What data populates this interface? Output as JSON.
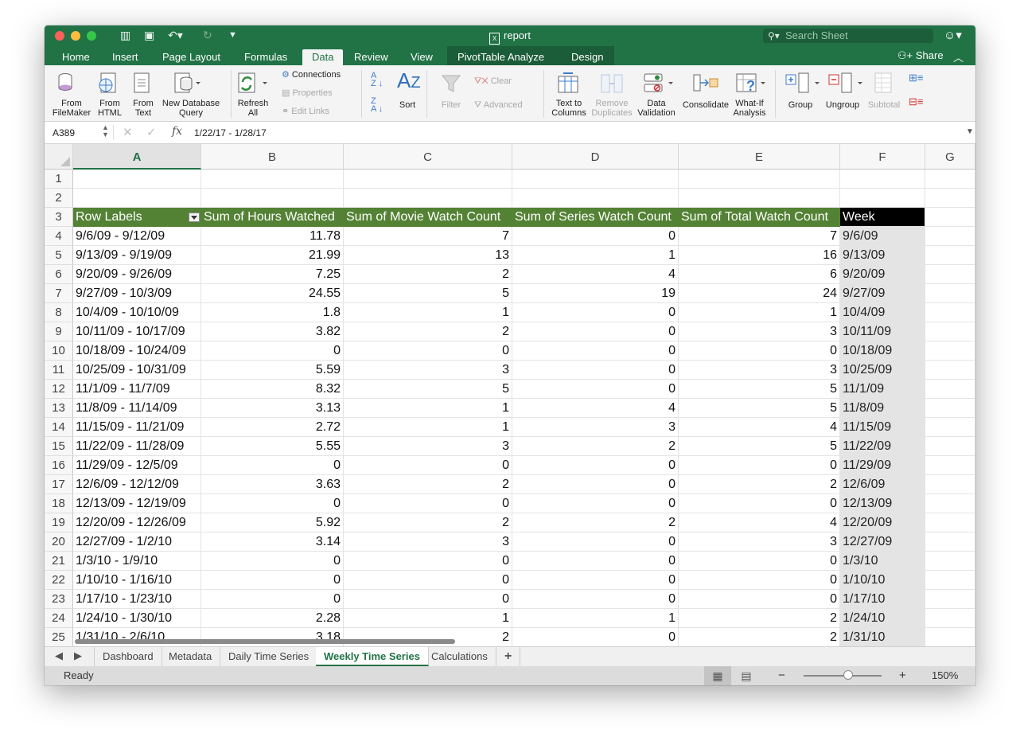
{
  "window": {
    "title": "report",
    "search_placeholder": "Search Sheet",
    "quick_access": [
      "sidebar-icon",
      "save-icon",
      "undo-icon",
      "redo-icon",
      "customize-icon"
    ]
  },
  "tabs": [
    "Home",
    "Insert",
    "Page Layout",
    "Formulas",
    "Data",
    "Review",
    "View",
    "PivotTable Analyze",
    "Design"
  ],
  "active_tab": "Data",
  "share_label": "Share",
  "ribbon": {
    "from_filemaker": "From\nFileMaker",
    "from_html": "From\nHTML",
    "from_text": "From\nText",
    "new_db_query": "New Database\nQuery",
    "refresh_all": "Refresh\nAll",
    "connections": "Connections",
    "properties": "Properties",
    "edit_links": "Edit Links",
    "sort": "Sort",
    "filter": "Filter",
    "clear": "Clear",
    "advanced": "Advanced",
    "text_to_columns": "Text to\nColumns",
    "remove_duplicates": "Remove\nDuplicates",
    "data_validation": "Data\nValidation",
    "consolidate": "Consolidate",
    "what_if": "What-If\nAnalysis",
    "group": "Group",
    "ungroup": "Ungroup",
    "subtotal": "Subtotal"
  },
  "formula_bar": {
    "name_box": "A389",
    "fx": "fx",
    "value": "1/22/17 - 1/28/17"
  },
  "columns": [
    "A",
    "B",
    "C",
    "D",
    "E",
    "F",
    "G"
  ],
  "row_numbers": [
    "1",
    "2",
    "3",
    "4",
    "5",
    "6",
    "7",
    "8",
    "9",
    "10",
    "11",
    "12",
    "13",
    "14",
    "15",
    "16",
    "17",
    "18",
    "19",
    "20",
    "21",
    "22",
    "23",
    "24",
    "25"
  ],
  "table": {
    "headers": [
      "Row Labels",
      "Sum of Hours Watched",
      "Sum of Movie Watch Count",
      "Sum of Series Watch Count",
      "Sum of Total Watch Count",
      "Week"
    ],
    "rows": [
      [
        "9/6/09 - 9/12/09",
        "11.78",
        "7",
        "0",
        "7",
        "9/6/09"
      ],
      [
        "9/13/09 - 9/19/09",
        "21.99",
        "13",
        "1",
        "16",
        "9/13/09"
      ],
      [
        "9/20/09 - 9/26/09",
        "7.25",
        "2",
        "4",
        "6",
        "9/20/09"
      ],
      [
        "9/27/09 - 10/3/09",
        "24.55",
        "5",
        "19",
        "24",
        "9/27/09"
      ],
      [
        "10/4/09 - 10/10/09",
        "1.8",
        "1",
        "0",
        "1",
        "10/4/09"
      ],
      [
        "10/11/09 - 10/17/09",
        "3.82",
        "2",
        "0",
        "3",
        "10/11/09"
      ],
      [
        "10/18/09 - 10/24/09",
        "0",
        "0",
        "0",
        "0",
        "10/18/09"
      ],
      [
        "10/25/09 - 10/31/09",
        "5.59",
        "3",
        "0",
        "3",
        "10/25/09"
      ],
      [
        "11/1/09 - 11/7/09",
        "8.32",
        "5",
        "0",
        "5",
        "11/1/09"
      ],
      [
        "11/8/09 - 11/14/09",
        "3.13",
        "1",
        "4",
        "5",
        "11/8/09"
      ],
      [
        "11/15/09 - 11/21/09",
        "2.72",
        "1",
        "3",
        "4",
        "11/15/09"
      ],
      [
        "11/22/09 - 11/28/09",
        "5.55",
        "3",
        "2",
        "5",
        "11/22/09"
      ],
      [
        "11/29/09 - 12/5/09",
        "0",
        "0",
        "0",
        "0",
        "11/29/09"
      ],
      [
        "12/6/09 - 12/12/09",
        "3.63",
        "2",
        "0",
        "2",
        "12/6/09"
      ],
      [
        "12/13/09 - 12/19/09",
        "0",
        "0",
        "0",
        "0",
        "12/13/09"
      ],
      [
        "12/20/09 - 12/26/09",
        "5.92",
        "2",
        "2",
        "4",
        "12/20/09"
      ],
      [
        "12/27/09 - 1/2/10",
        "3.14",
        "3",
        "0",
        "3",
        "12/27/09"
      ],
      [
        "1/3/10 - 1/9/10",
        "0",
        "0",
        "0",
        "0",
        "1/3/10"
      ],
      [
        "1/10/10 - 1/16/10",
        "0",
        "0",
        "0",
        "0",
        "1/10/10"
      ],
      [
        "1/17/10 - 1/23/10",
        "0",
        "0",
        "0",
        "0",
        "1/17/10"
      ],
      [
        "1/24/10 - 1/30/10",
        "2.28",
        "1",
        "1",
        "2",
        "1/24/10"
      ],
      [
        "1/31/10 - 2/6/10",
        "3.18",
        "2",
        "0",
        "2",
        "1/31/10"
      ]
    ]
  },
  "sheets": [
    "Dashboard",
    "Metadata",
    "Daily Time Series",
    "Weekly Time Series",
    "Calculations"
  ],
  "active_sheet": "Weekly Time Series",
  "add_sheet": "+",
  "status": {
    "text": "Ready",
    "zoom": "150%",
    "zoom_minus": "−",
    "zoom_plus": "+"
  },
  "colors": {
    "accent": "#217346",
    "pivot_header": "#548235"
  }
}
